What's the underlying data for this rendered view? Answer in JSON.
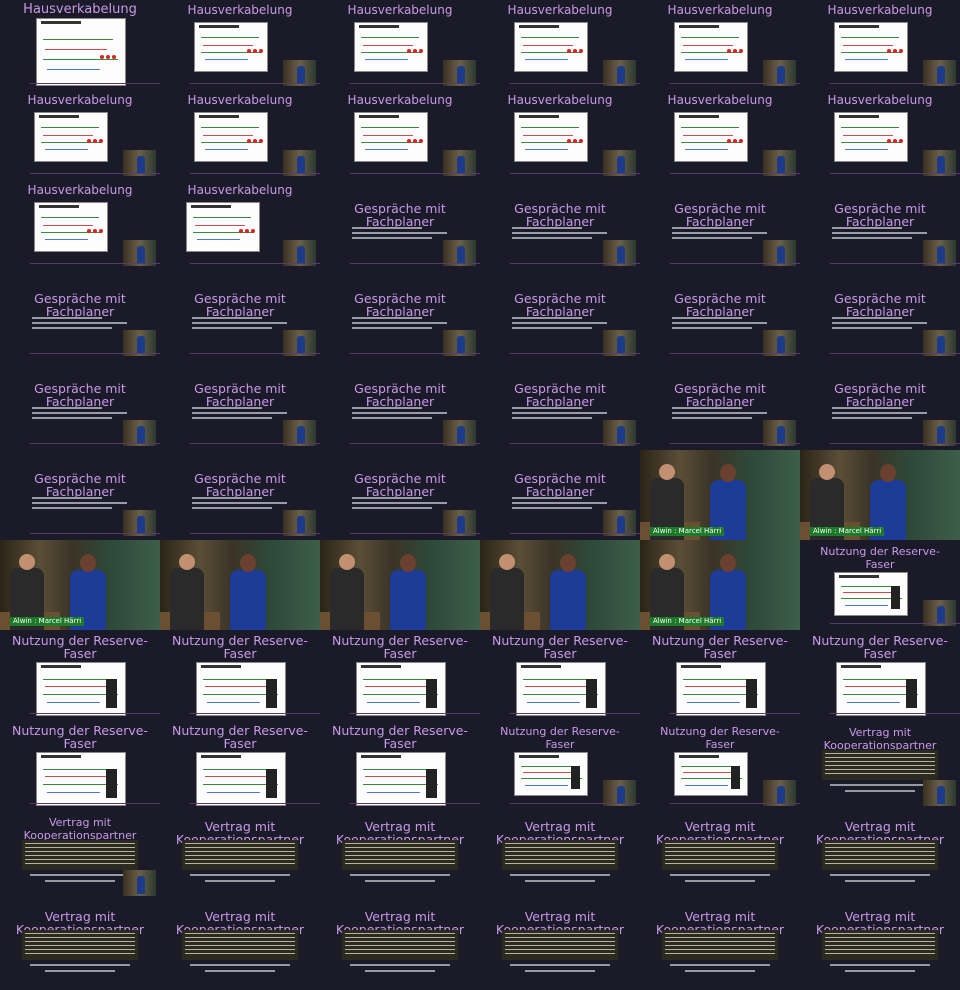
{
  "slides": {
    "haus": "Hausverkabelung",
    "fach": "Gespräche mit\nFachplaner",
    "nutz": "Nutzung der Reserve-\nFaser",
    "vert": "Vertrag mit\nKooperationspartner"
  },
  "lower_third": "Alwin : Marcel Härri",
  "tiles": [
    "haus-full",
    "haus",
    "haus",
    "haus",
    "haus",
    "haus",
    "haus",
    "haus",
    "haus",
    "haus",
    "haus",
    "haus",
    "haus",
    "haus-b",
    "fach",
    "fach",
    "fach",
    "fach",
    "fach",
    "fach",
    "fach",
    "fach",
    "fach",
    "fach",
    "fach",
    "fach",
    "fach",
    "fach",
    "fach",
    "fach",
    "fach",
    "fach",
    "fach",
    "fach",
    "photo-l",
    "photo-l",
    "photo-l",
    "photo",
    "photo",
    "photo",
    "photo-l",
    "nutz-s",
    "nutz",
    "nutz",
    "nutz",
    "nutz",
    "nutz",
    "nutz",
    "nutz",
    "nutz",
    "nutz",
    "nutz-s",
    "nutz-s",
    "vert-s",
    "vert-s",
    "vert",
    "vert",
    "vert",
    "vert",
    "vert",
    "vert",
    "vert",
    "vert",
    "vert",
    "vert",
    "vert"
  ],
  "colors": {
    "title": "#c89ae8",
    "slide_bg": "#1a1a28",
    "lower_third_bg": "#1c7a2a"
  }
}
